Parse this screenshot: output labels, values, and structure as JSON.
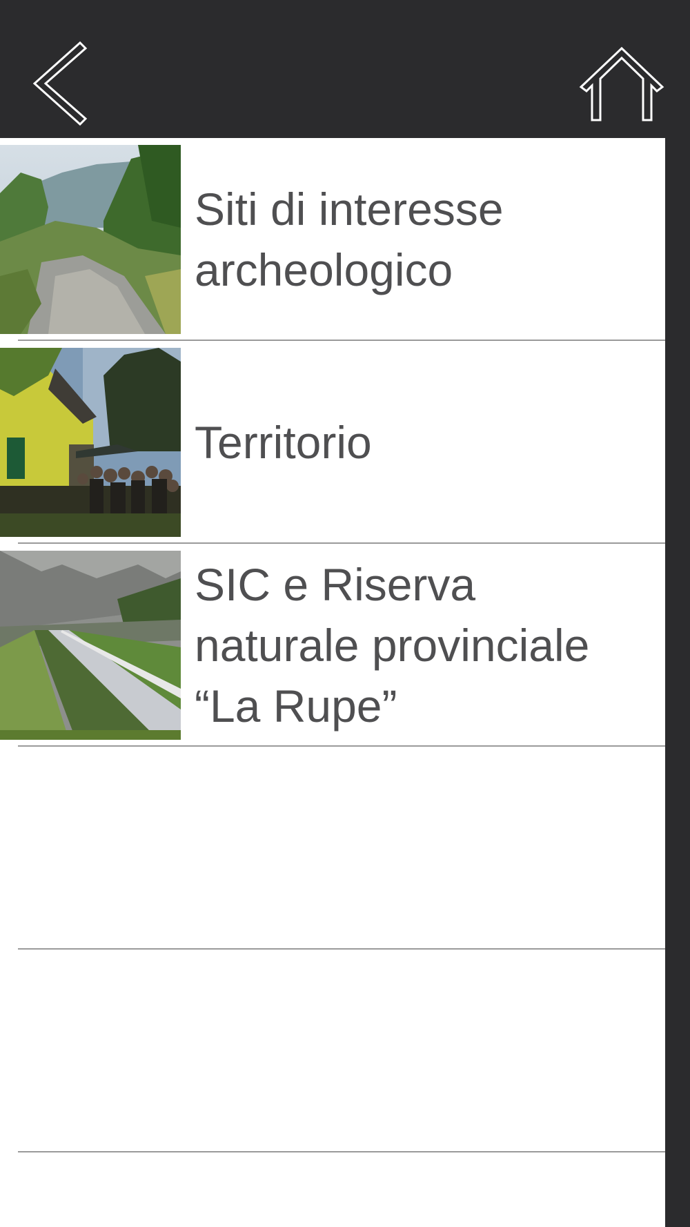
{
  "header": {
    "back_icon": "chevron-left-icon",
    "home_icon": "home-outline-icon",
    "background": "#2b2b2d",
    "icon_color": "#ffffff"
  },
  "list": {
    "items": [
      {
        "label": "Siti di interesse archeologico",
        "thumbnail": "river-valley-photo"
      },
      {
        "label": "Territorio",
        "thumbnail": "evening-event-photo"
      },
      {
        "label": "SIC e Riserva naturale provinciale “La Rupe”",
        "thumbnail": "cliff-road-photo"
      }
    ],
    "text_color": "#4f4f51",
    "separator_color": "#9a9a9a"
  }
}
